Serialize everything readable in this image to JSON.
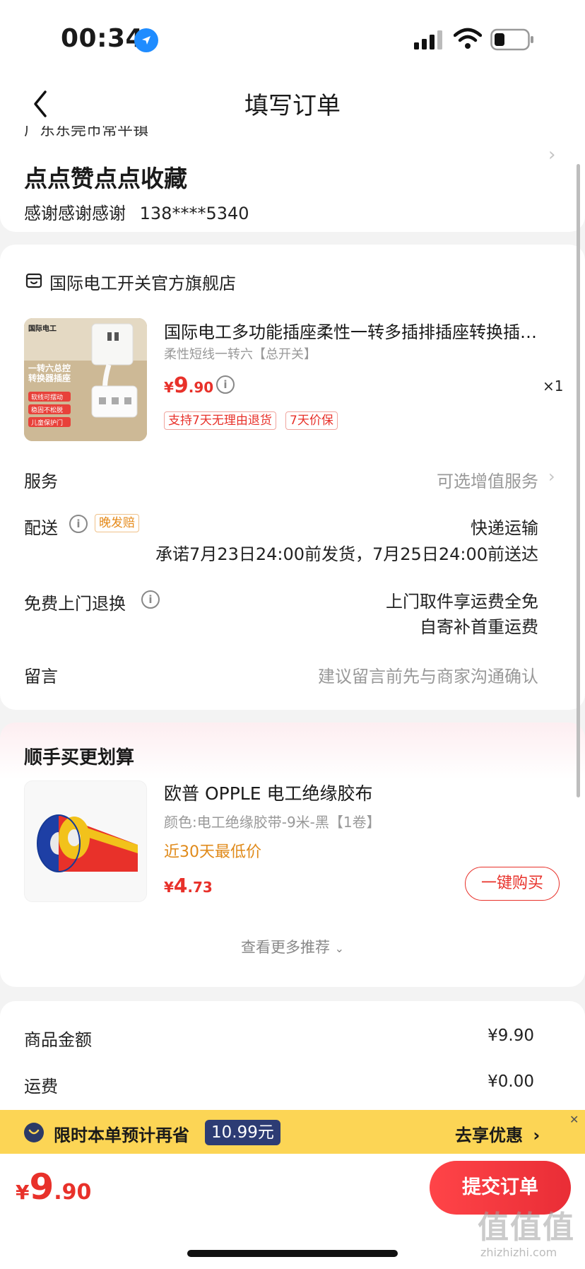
{
  "status_bar": {
    "time": "00:34"
  },
  "nav": {
    "title": "填写订单"
  },
  "address": {
    "partial_line": "广东东莞市常平镇",
    "name": "点点赞点点收藏",
    "contact_name": "感谢感谢感谢",
    "phone": "138****5340"
  },
  "shop": {
    "name": "国际电工开关官方旗舰店"
  },
  "product": {
    "title": "国际电工多功能插座柔性一转多插排插座转换插…",
    "spec": "柔性短线一转六【总开关】",
    "currency": "¥",
    "price_int": "9",
    "price_dec": ".90",
    "qty": "×1",
    "tags": [
      "支持7天无理由退货",
      "7天价保"
    ],
    "image_text": {
      "brand": "国际电工",
      "headline": "一转六总控\n转换器插座",
      "bullets": [
        "软线可摆动",
        "稳固不松脱",
        "儿童保护门"
      ]
    }
  },
  "rows": {
    "service_label": "服务",
    "service_value": "可选增值服务",
    "delivery_label": "配送",
    "delivery_tag": "晚发赔",
    "delivery_method": "快递运输",
    "delivery_promise": "承诺7月23日24:00前发货，7月25日24:00前送达",
    "return_label": "免费上门退换",
    "return_line1": "上门取件享运费全免",
    "return_line2": "自寄补首重运费",
    "note_label": "留言",
    "note_placeholder": "建议留言前先与商家沟通确认"
  },
  "recommend": {
    "title": "顺手买更划算",
    "item_name": "欧普 OPPLE 电工绝缘胶布",
    "item_spec": "颜色:电工绝缘胶带-9米-黑【1卷】",
    "item_badge": "近30天最低价",
    "currency": "¥",
    "price_int": "4",
    "price_dec": ".73",
    "buy_label": "一键购买",
    "more_label": "查看更多推荐"
  },
  "summary": {
    "goods_label": "商品金额",
    "goods_value": "¥9.90",
    "shipping_label": "运费",
    "shipping_value": "¥0.00"
  },
  "promo": {
    "text": "限时本单预计再省",
    "amount": "10.99元",
    "action": "去享优惠"
  },
  "bottom": {
    "currency": "¥",
    "total_int": "9",
    "total_dec": ".90",
    "submit_label": "提交订单"
  },
  "watermark": {
    "main": "值值值",
    "sub": "zhizhizhi.com"
  },
  "colors": {
    "accent_red": "#e8312a",
    "promo_yellow": "#fcd555",
    "promo_navy": "#2d3c74",
    "location_blue": "#1f8cff",
    "low_price_orange": "#e08a1a"
  }
}
